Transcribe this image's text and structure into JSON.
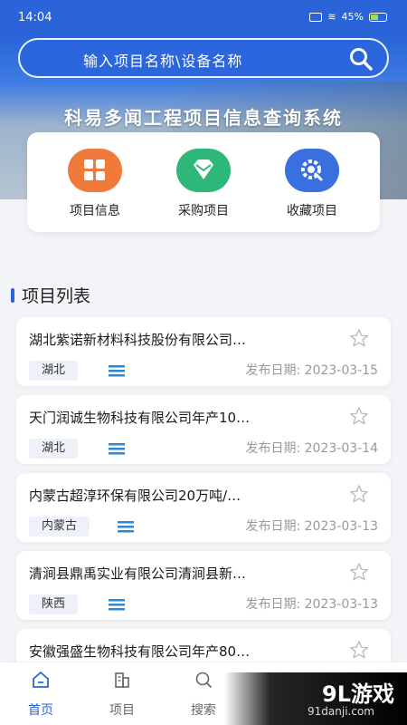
{
  "status_bar": {
    "time": "14:04",
    "battery": "45%"
  },
  "search": {
    "placeholder": "输入项目名称\\设备名称"
  },
  "app_title": "科易多闻工程项目信息查询系统",
  "quick_actions": [
    {
      "label": "项目信息",
      "icon": "grid-icon",
      "color": "#f07a3c"
    },
    {
      "label": "采购项目",
      "icon": "diamond-icon",
      "color": "#2db87a"
    },
    {
      "label": "收藏项目",
      "icon": "gear-search-icon",
      "color": "#3a6fe0"
    }
  ],
  "section_title": "项目列表",
  "projects": [
    {
      "title": "湖北紫诺新材料科技股份有限公司…",
      "region": "湖北",
      "date": "发布日期: 2023-03-15"
    },
    {
      "title": "天门润诚生物科技有限公司年产10…",
      "region": "湖北",
      "date": "发布日期: 2023-03-14"
    },
    {
      "title": "内蒙古超淳环保有限公司20万吨/…",
      "region": "内蒙古",
      "date": "发布日期: 2023-03-13"
    },
    {
      "title": "清涧县鼎禹实业有限公司清涧县新…",
      "region": "陕西",
      "date": "发布日期: 2023-03-13"
    },
    {
      "title": "安徽强盛生物科技有限公司年产80…",
      "region": "",
      "date": ""
    }
  ],
  "tabs": [
    {
      "label": "首页",
      "icon": "home-icon",
      "active": true
    },
    {
      "label": "项目",
      "icon": "building-icon",
      "active": false
    },
    {
      "label": "搜索",
      "icon": "search-icon",
      "active": false
    }
  ],
  "watermark": {
    "logo": "9L游戏",
    "url": "91danji.com"
  },
  "colors": {
    "primary": "#2a64d8",
    "background": "#f3f4f7"
  }
}
